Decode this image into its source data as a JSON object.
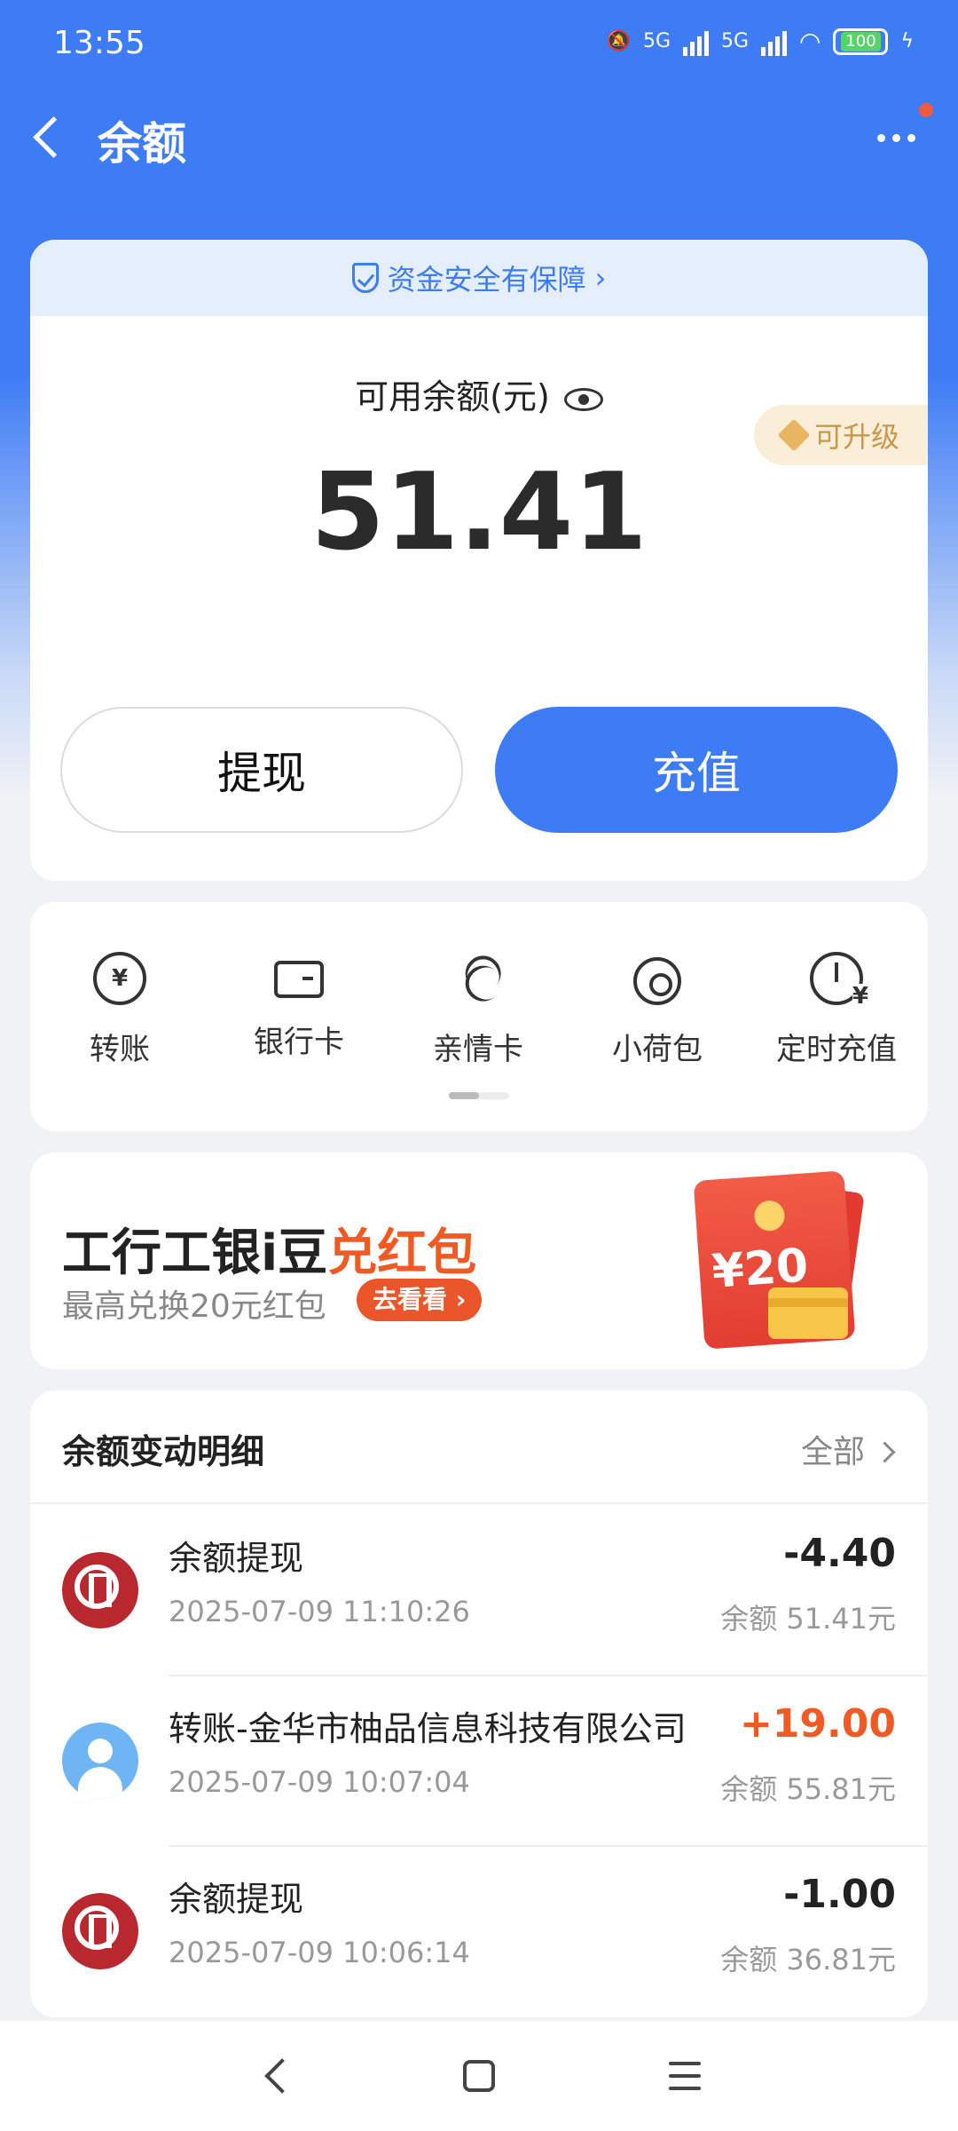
{
  "status": {
    "time": "13:55",
    "network1": "5G",
    "network2": "5G",
    "battery": "100"
  },
  "nav": {
    "title": "余额"
  },
  "balance": {
    "security_note": "资金安全有保障",
    "label": "可用余额(元)",
    "amount": "51.41",
    "upgrade_label": "可升级",
    "withdraw_label": "提现",
    "recharge_label": "充值"
  },
  "shortcuts": [
    {
      "label": "转账",
      "icon": "transfer-icon"
    },
    {
      "label": "银行卡",
      "icon": "bank-card-icon"
    },
    {
      "label": "亲情卡",
      "icon": "family-card-icon"
    },
    {
      "label": "小荷包",
      "icon": "purse-icon"
    },
    {
      "label": "定时充值",
      "icon": "scheduled-recharge-icon"
    }
  ],
  "promo": {
    "title_main": "工行工银i豆",
    "title_highlight": "兑红包",
    "subtitle": "最高兑换20元红包",
    "button": "去看看",
    "envelope_amount": "¥20"
  },
  "transactions": {
    "title": "余额变动明细",
    "all_label": "全部",
    "items": [
      {
        "name": "余额提现",
        "time": "2025-07-09 11:10:26",
        "amount": "-4.40",
        "balance_after": "余额 51.41元",
        "type": "bank"
      },
      {
        "name": "转账-金华市柚品信息科技有限公司",
        "time": "2025-07-09 10:07:04",
        "amount": "+19.00",
        "balance_after": "余额 55.81元",
        "type": "person"
      },
      {
        "name": "余额提现",
        "time": "2025-07-09 10:06:14",
        "amount": "-1.00",
        "balance_after": "余额 36.81元",
        "type": "bank"
      }
    ]
  },
  "colors": {
    "primary": "#3d7cf5",
    "accent": "#f05a25",
    "background": "#f1f2f6"
  }
}
